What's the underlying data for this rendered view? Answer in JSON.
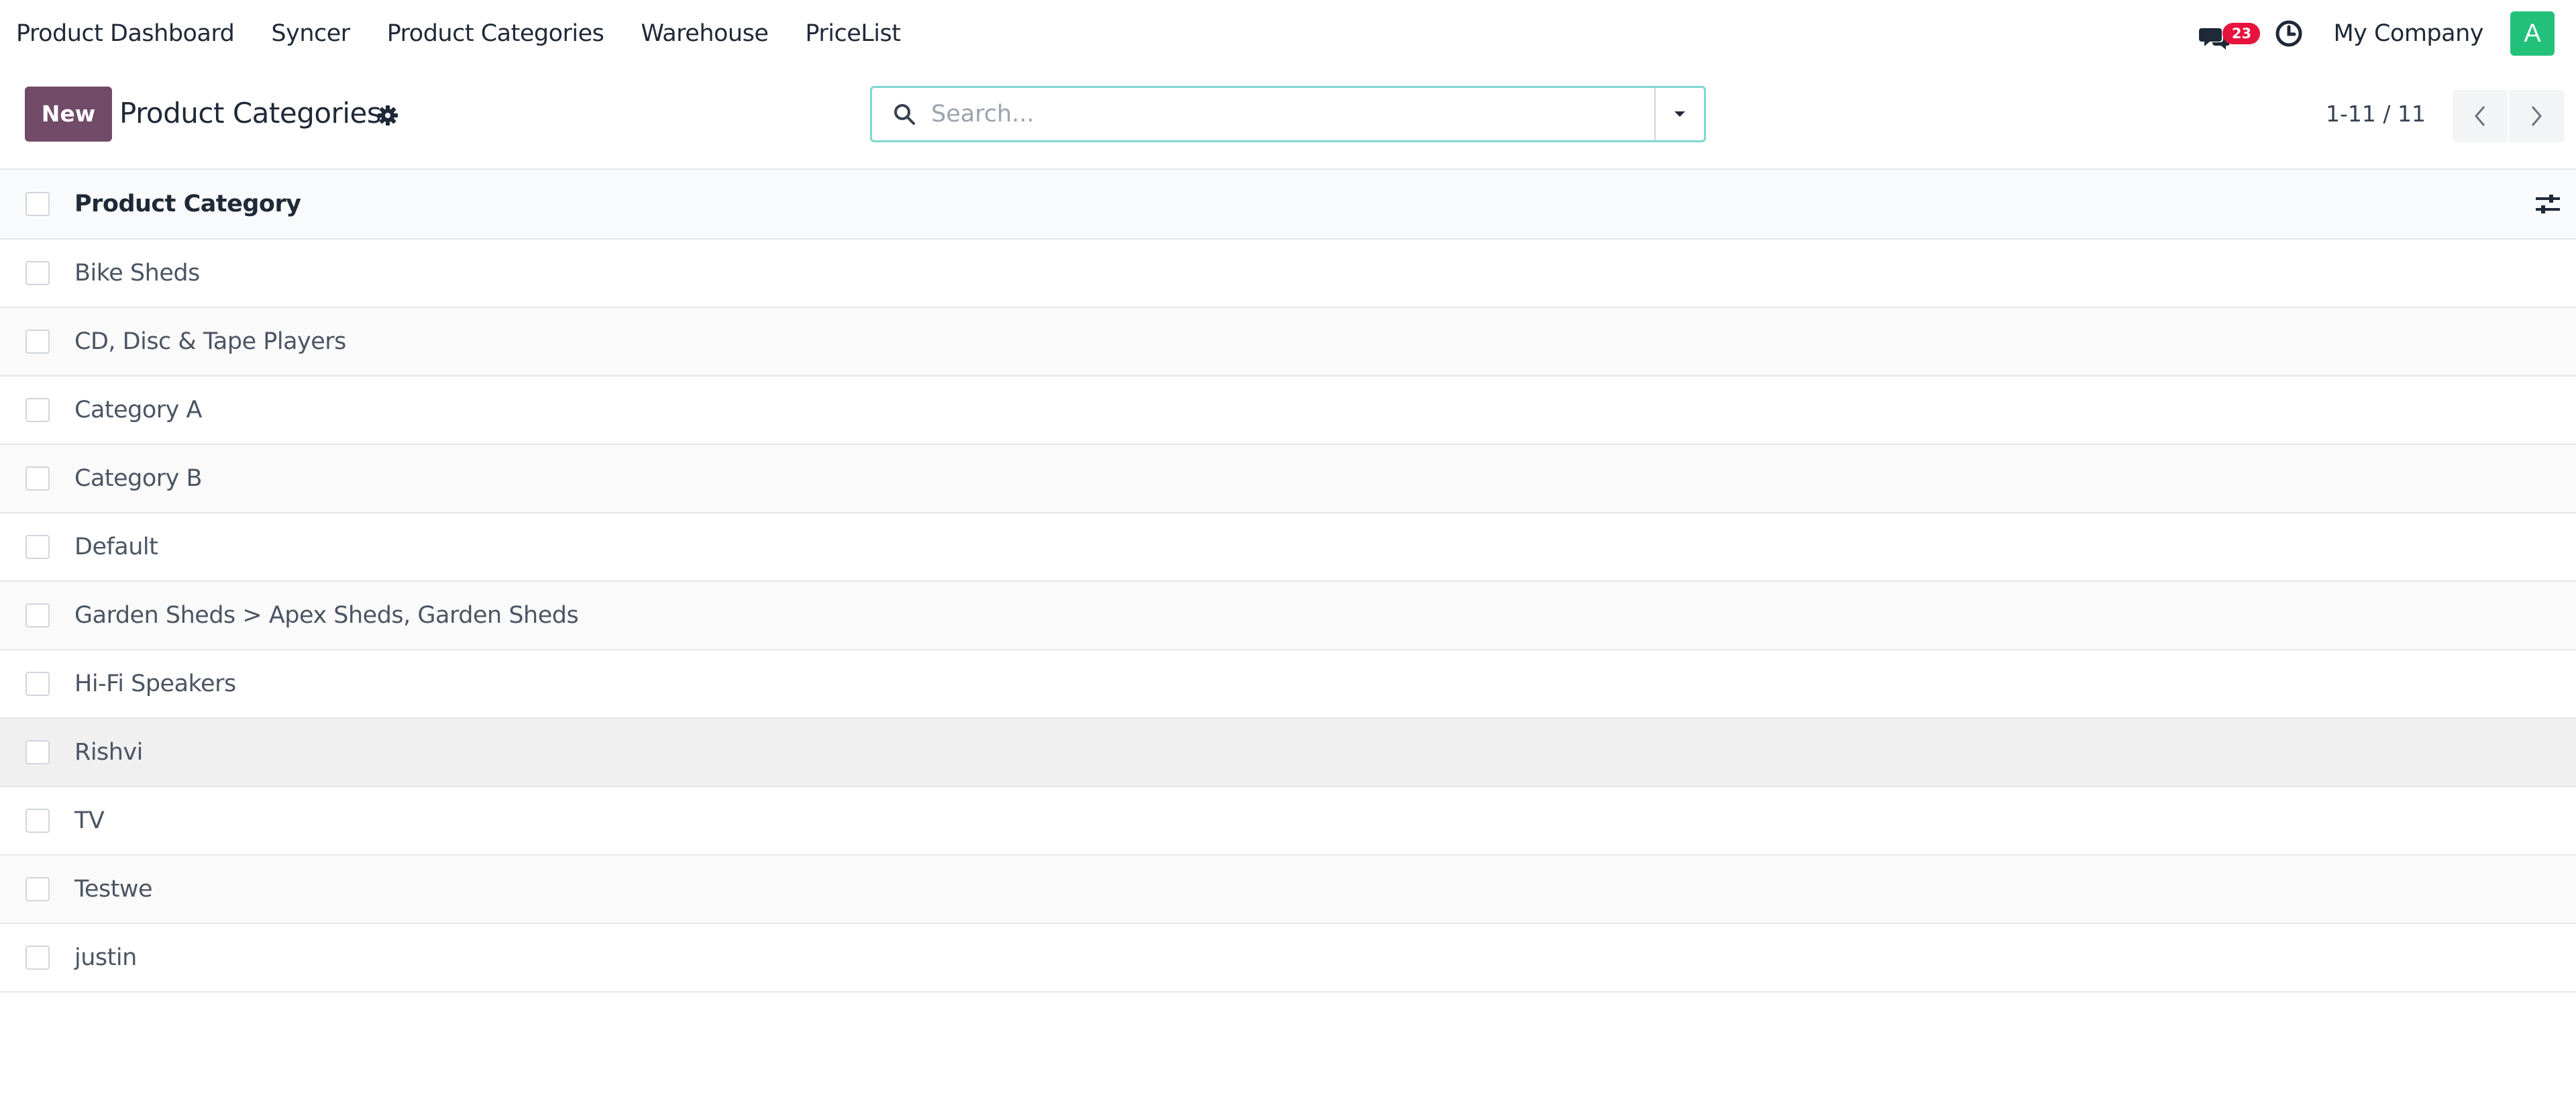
{
  "navbar": {
    "menu": [
      {
        "label": "Product Dashboard"
      },
      {
        "label": "Syncer"
      },
      {
        "label": "Product Categories"
      },
      {
        "label": "Warehouse"
      },
      {
        "label": "PriceList"
      }
    ],
    "messages_badge": "23",
    "company": "My Company",
    "avatar_letter": "A",
    "avatar_color": "#21c17a"
  },
  "control_panel": {
    "new_label": "New",
    "title": "Product Categories",
    "search_placeholder": "Search...",
    "pager": "1-11 / 11"
  },
  "list": {
    "column_header": "Product Category",
    "rows": [
      {
        "name": "Bike Sheds"
      },
      {
        "name": "CD, Disc & Tape Players"
      },
      {
        "name": "Category A"
      },
      {
        "name": "Category B"
      },
      {
        "name": "Default"
      },
      {
        "name": "Garden Sheds > Apex Sheds, Garden Sheds"
      },
      {
        "name": "Hi-Fi Speakers"
      },
      {
        "name": "Rishvi"
      },
      {
        "name": "TV"
      },
      {
        "name": "Testwe"
      },
      {
        "name": "justin"
      }
    ]
  },
  "colors": {
    "primary": "#714b67",
    "badge": "#e8133d",
    "search_border": "#7fd7d3"
  },
  "icons": {
    "messages": "chat-bubbles-icon",
    "activity": "clock-icon",
    "settings": "gear-icon",
    "search": "search-icon",
    "search_toggle": "caret-down-icon",
    "pager_prev": "chevron-left-icon",
    "pager_next": "chevron-right-icon",
    "optional_columns": "sliders-icon"
  }
}
